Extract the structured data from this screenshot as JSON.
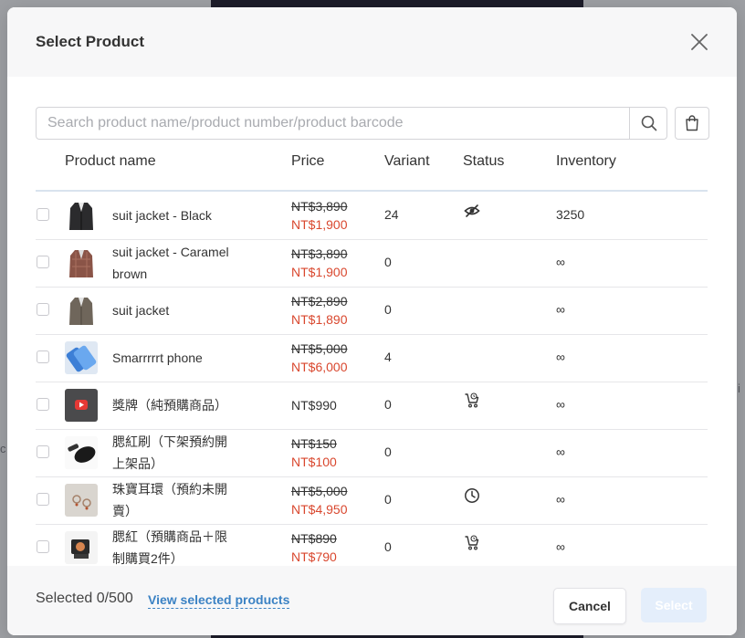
{
  "background": {
    "left_text": "c",
    "right_text": "i"
  },
  "modal": {
    "title": "Select Product",
    "close_icon": "close-icon"
  },
  "search": {
    "placeholder": "Search product name/product number/product barcode",
    "value": "",
    "search_icon": "search-icon",
    "bag_icon": "shopping-bag-icon"
  },
  "table": {
    "headers": {
      "name": "Product name",
      "price": "Price",
      "variant": "Variant",
      "status": "Status",
      "inventory": "Inventory"
    },
    "rows": [
      {
        "name": "suit jacket - Black",
        "price_original": "NT$3,890",
        "price_sale": "NT$1,900",
        "variant": "24",
        "status_icon": "hidden-eye-icon",
        "inventory": "3250",
        "thumb": "black-suit"
      },
      {
        "name": "suit jacket - Caramel brown",
        "price_original": "NT$3,890",
        "price_sale": "NT$1,900",
        "variant": "0",
        "status_icon": "",
        "inventory": "∞",
        "thumb": "brown-suit"
      },
      {
        "name": "suit jacket",
        "price_original": "NT$2,890",
        "price_sale": "NT$1,890",
        "variant": "0",
        "status_icon": "",
        "inventory": "∞",
        "thumb": "grey-suit"
      },
      {
        "name": "Smarrrrrt phone",
        "price_original": "NT$5,000",
        "price_sale": "NT$6,000",
        "variant": "4",
        "status_icon": "",
        "inventory": "∞",
        "thumb": "phone"
      },
      {
        "name": "獎牌（純預購商品）",
        "price_original": "",
        "price_sale": "",
        "price_plain": "NT$990",
        "variant": "0",
        "status_icon": "preorder-cart-icon",
        "inventory": "∞",
        "thumb": "video"
      },
      {
        "name": "腮紅刷（下架預約開上架品）",
        "price_original": "NT$150",
        "price_sale": "NT$100",
        "variant": "0",
        "status_icon": "",
        "inventory": "∞",
        "thumb": "brush"
      },
      {
        "name": "珠寶耳環（預約未開賣）",
        "price_original": "NT$5,000",
        "price_sale": "NT$4,950",
        "variant": "0",
        "status_icon": "clock-icon",
        "inventory": "∞",
        "thumb": "earring"
      },
      {
        "name": "腮紅（預購商品＋限制購買2件）",
        "price_original": "NT$890",
        "price_sale": "NT$790",
        "variant": "0",
        "status_icon": "preorder-cart-icon",
        "inventory": "∞",
        "thumb": "blush"
      }
    ]
  },
  "footer": {
    "selected": "Selected 0/500",
    "view_link": "View selected products",
    "cancel": "Cancel",
    "select": "Select"
  },
  "colors": {
    "sale_price": "#d9472e",
    "link": "#3b82c4",
    "select_disabled": "#e4eefb"
  }
}
